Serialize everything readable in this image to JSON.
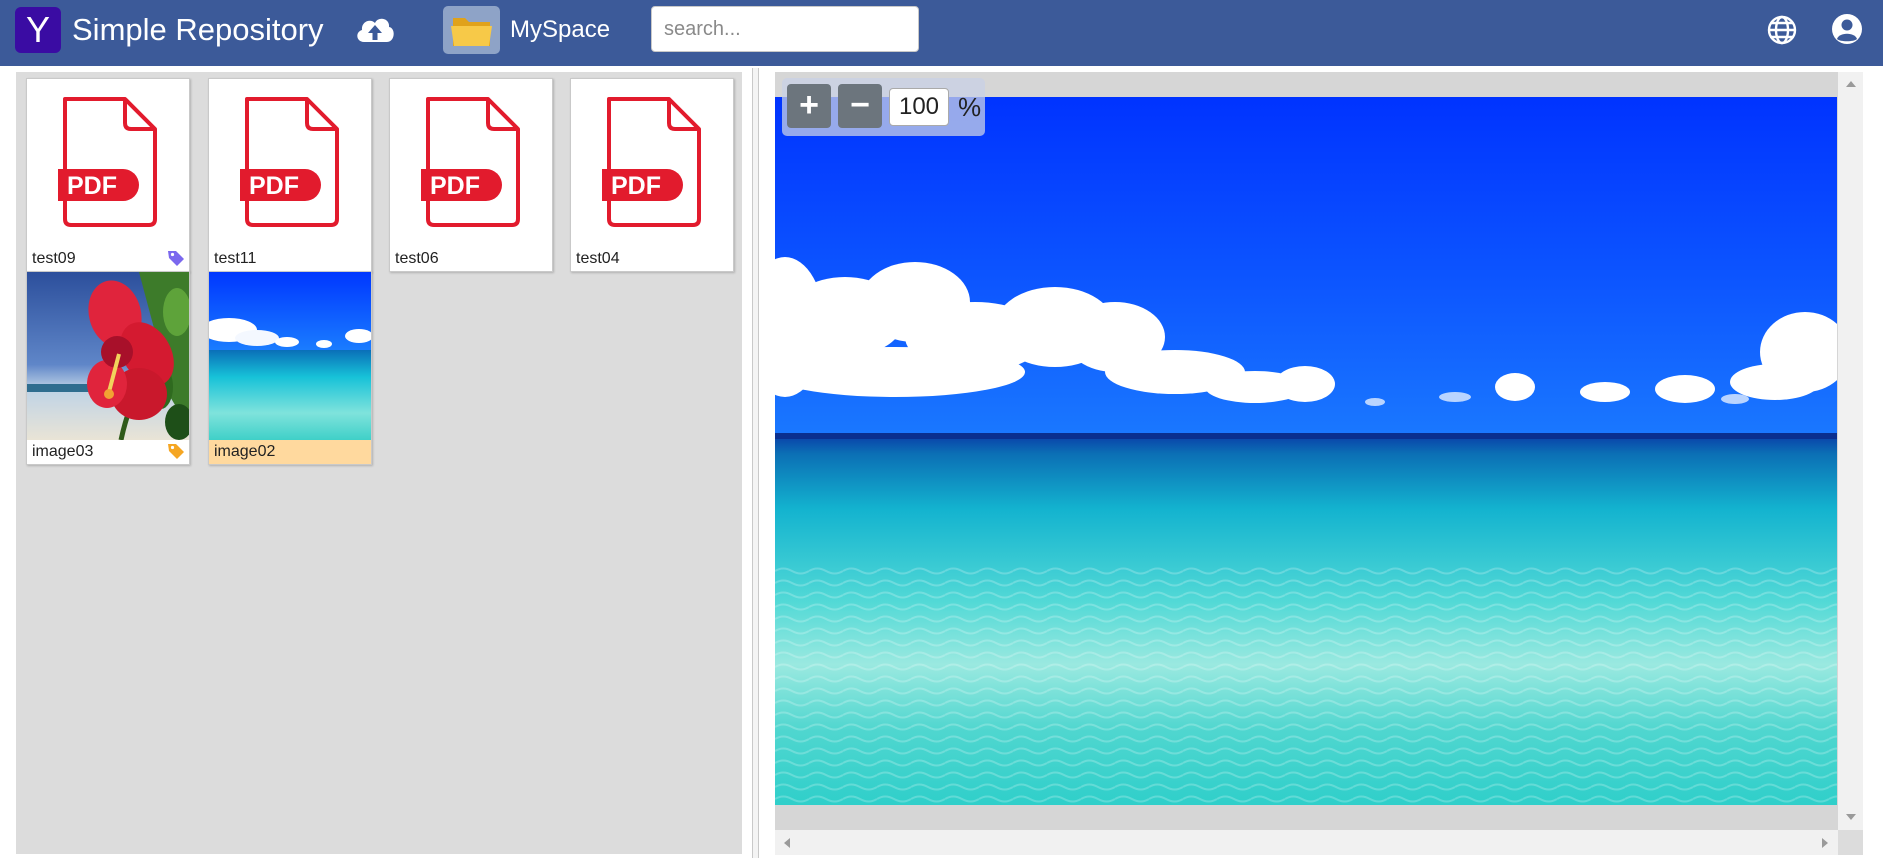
{
  "header": {
    "logo_letter": "Y",
    "title": "Simple Repository",
    "myspace_label": "MySpace",
    "search_placeholder": "search...",
    "bg_color": "#3c5a99",
    "icons": [
      "cloud-upload-icon",
      "folder-icon",
      "globe-icon",
      "user-icon"
    ]
  },
  "files": [
    {
      "name": "test09",
      "type": "pdf",
      "tag": "purple",
      "selected": false
    },
    {
      "name": "test11",
      "type": "pdf",
      "tag": null,
      "selected": false
    },
    {
      "name": "test06",
      "type": "pdf",
      "tag": null,
      "selected": false
    },
    {
      "name": "test04",
      "type": "pdf",
      "tag": null,
      "selected": false
    },
    {
      "name": "image03",
      "type": "image",
      "tag": "orange",
      "selected": false
    },
    {
      "name": "image02",
      "type": "image",
      "tag": null,
      "selected": true
    }
  ],
  "pdf_badge": "PDF",
  "tag_colors": {
    "purple": "#7b68ee",
    "orange": "#f5a623"
  },
  "viewer": {
    "zoom_in_label": "+",
    "zoom_out_label": "−",
    "zoom_value": "100",
    "zoom_unit": "%"
  }
}
